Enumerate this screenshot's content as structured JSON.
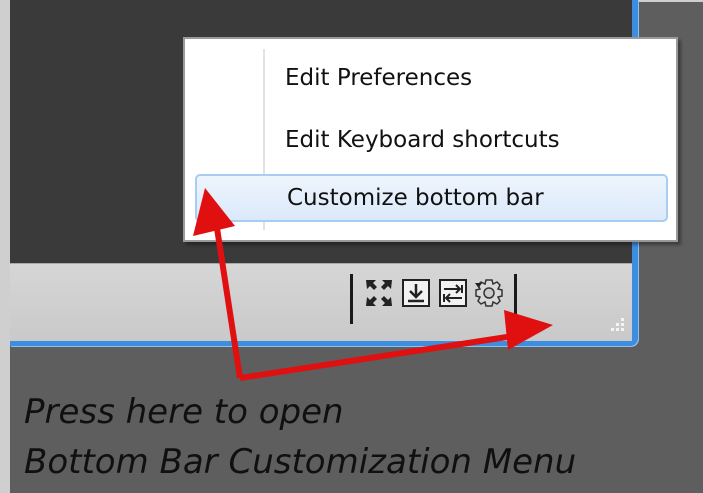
{
  "menu": {
    "items": [
      {
        "label": "Edit Preferences",
        "highlighted": false
      },
      {
        "label": "Edit Keyboard shortcuts",
        "highlighted": false
      },
      {
        "label": "Customize bottom bar",
        "highlighted": true
      }
    ]
  },
  "bottom_bar": {
    "icons": [
      "expand-icon",
      "download-icon",
      "swap-icon",
      "settings-gear-icon",
      "resize-grip-icon"
    ]
  },
  "annotation": {
    "line1": "Press here to open",
    "line2": "Bottom Bar Customization Menu",
    "arrow_color": "#e01010"
  },
  "colors": {
    "window_border": "#3d8de0",
    "background": "#5e5e5e",
    "menu_highlight": "#dbe9fa"
  }
}
